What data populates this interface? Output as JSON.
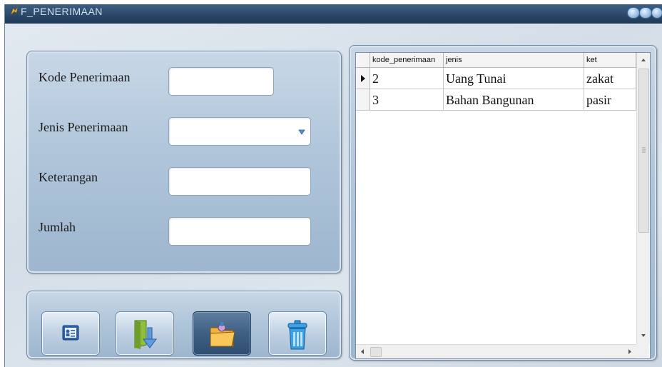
{
  "window": {
    "title": "F_PENERIMAAN"
  },
  "form": {
    "kode_label": "Kode Penerimaan",
    "kode_value": "",
    "jenis_label": "Jenis Penerimaan",
    "jenis_value": "",
    "keterangan_label": "Keterangan",
    "keterangan_value": "",
    "jumlah_label": "Jumlah",
    "jumlah_value": ""
  },
  "buttons": [
    {
      "name": "new-record-button",
      "icon": "id-card-icon",
      "pressed": false
    },
    {
      "name": "save-button",
      "icon": "save-download-icon",
      "pressed": false
    },
    {
      "name": "open-folder-button",
      "icon": "folder-icon",
      "pressed": true
    },
    {
      "name": "delete-button",
      "icon": "trash-icon",
      "pressed": false
    }
  ],
  "grid": {
    "columns": [
      "kode_penerimaan",
      "jenis",
      "ket"
    ],
    "rows": [
      {
        "kode": "2",
        "jenis": "Uang Tunai",
        "ket": "zakat",
        "current": true
      },
      {
        "kode": "3",
        "jenis": "Bahan Bangunan",
        "ket": "pasir",
        "current": false
      }
    ]
  },
  "colors": {
    "titlebar": "#2a4667",
    "panel": "#aec4d9",
    "pressed_button": "#3f5f82"
  }
}
